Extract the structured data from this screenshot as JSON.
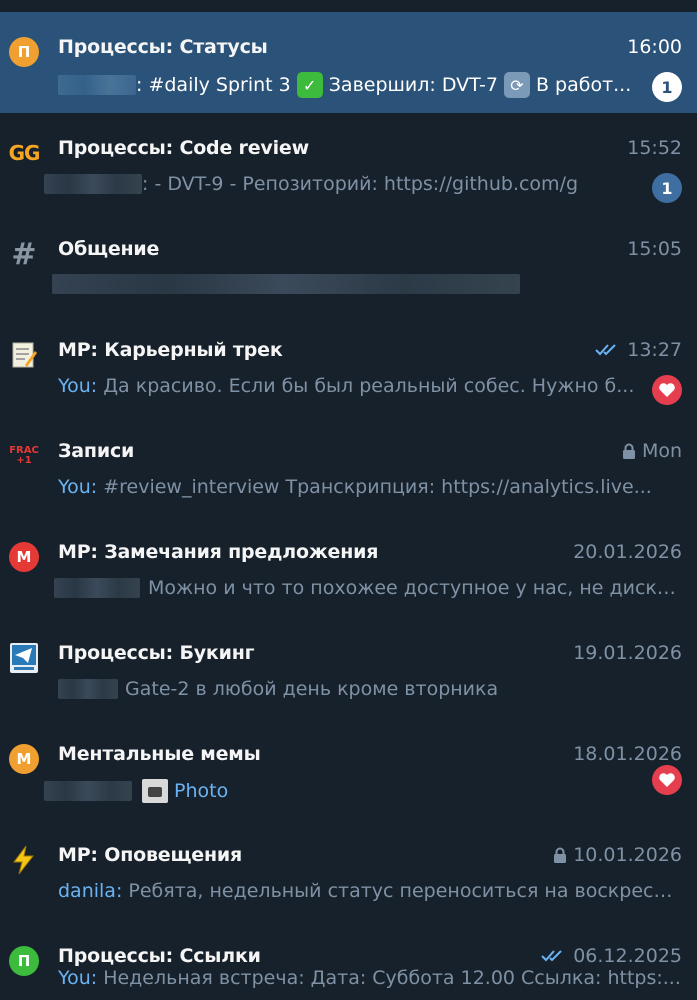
{
  "colors": {
    "background": "#17212b",
    "selected_row": "#2b5278",
    "muted_text": "#7f91a4",
    "link_blue": "#6ab3f3",
    "badge_blue": "#3e6fa0",
    "heart_red": "#e53e4e"
  },
  "chats": [
    {
      "title": "Процессы: Статусы",
      "time": "16:00",
      "avatar_letter": "П",
      "avatar_color": "#f0a030",
      "selected": true,
      "preview_pre": ": #daily Sprint 3",
      "preview_mid": "Завершил: DVT-7",
      "preview_post": "В работ...",
      "unread": "1"
    },
    {
      "title": "Процессы: Code review",
      "time": "15:52",
      "avatar_icon": "gg-logo-icon",
      "avatar_text": "GG",
      "preview": ": - DVT-9  - Репозиторий: https://github.com/g",
      "unread": "1"
    },
    {
      "title": "Общение",
      "time": "15:05",
      "avatar_icon": "hashtag-icon",
      "avatar_text": "#"
    },
    {
      "title": "MP: Карьерный трек",
      "time": "13:27",
      "avatar_icon": "memo-icon",
      "sender": "You:",
      "preview": " Да красиво. Если бы был реальный собес. Нужно б...",
      "read_status": "double-check-icon",
      "reaction": "heart-icon"
    },
    {
      "title": "Записи",
      "time": "Mon",
      "avatar_icon": "frac-icon",
      "avatar_text": "FRAC +1",
      "sender": "You:",
      "preview": " #review_interview   Транскрипция: https://analytics.live...",
      "locked": true
    },
    {
      "title": "MP: Замечания предложения",
      "time": "20.01.2026",
      "avatar_letter": "М",
      "avatar_color": "#e53935",
      "preview": "Можно и что то похожее доступное у нас, не диско..."
    },
    {
      "title": "Процессы: Букинг",
      "time": "19.01.2026",
      "avatar_icon": "telegram-booking-icon",
      "preview": "Gate-2 в любой день кроме вторника"
    },
    {
      "title": "Ментальные мемы",
      "time": "18.01.2026",
      "avatar_letter": "М",
      "avatar_color": "#f0a030",
      "preview": "Photo",
      "reaction": "heart-icon"
    },
    {
      "title": "MP: Оповещения",
      "time": "10.01.2026",
      "avatar_icon": "lightning-icon",
      "sender": "danila:",
      "preview": " Ребята, недельный статус переноситься на воскресе...",
      "locked": true
    },
    {
      "title": "Процессы: Ссылки",
      "time": "06.12.2025",
      "avatar_letter": "П",
      "avatar_color": "#3dbb3d",
      "sender": "You:",
      "preview": " Недельная встреча: Дата: Суббота 12.00 Ссылка: https:...",
      "read_status": "double-check-icon"
    }
  ]
}
